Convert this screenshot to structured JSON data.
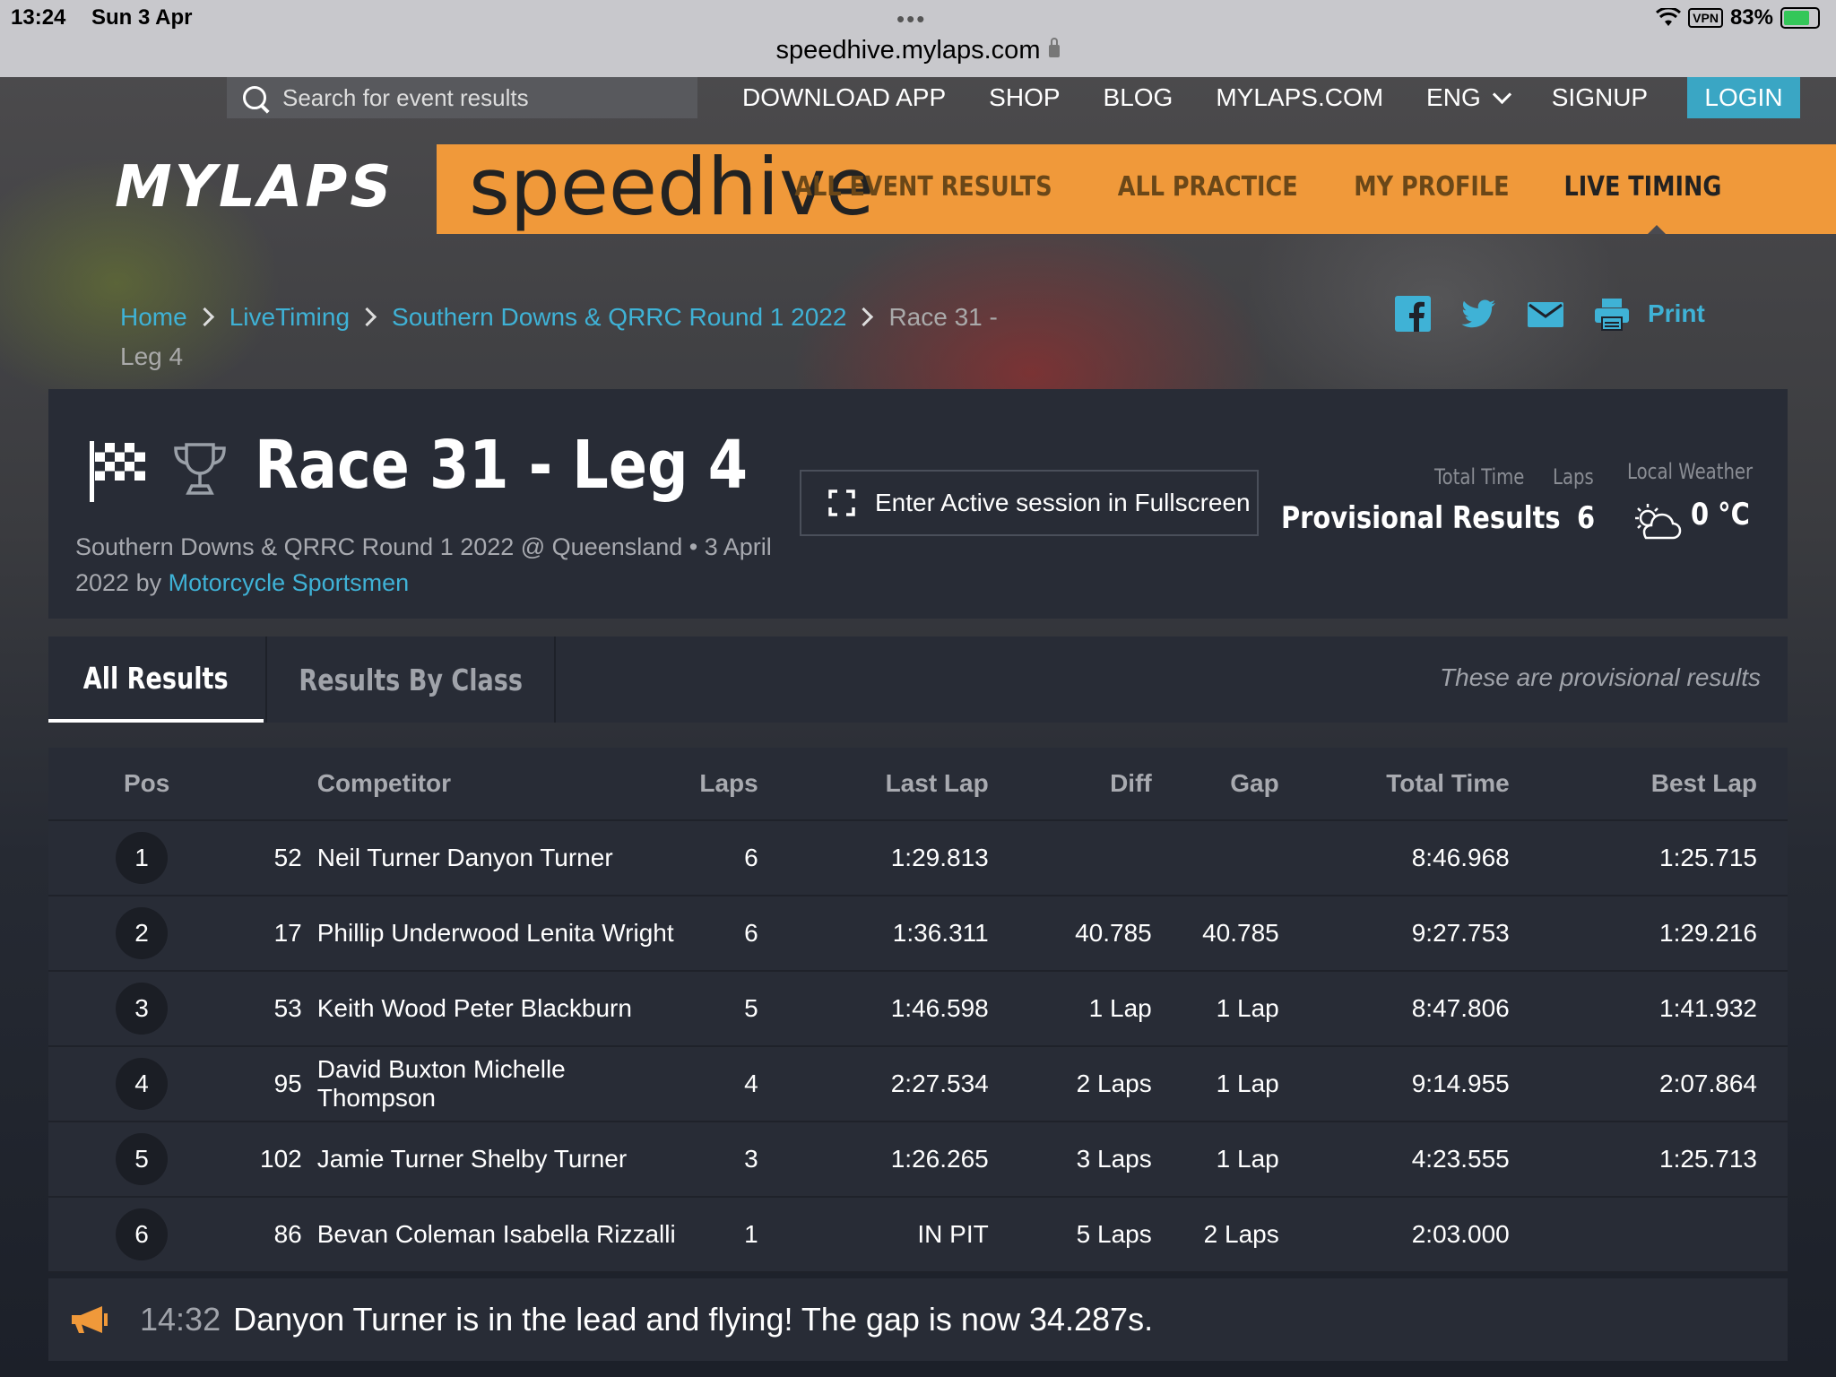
{
  "status_bar": {
    "time": "13:24",
    "date": "Sun 3 Apr",
    "url": "speedhive.mylaps.com",
    "vpn": "VPN",
    "battery": "83%"
  },
  "top_nav": {
    "search_placeholder": "Search for event results",
    "links": [
      "DOWNLOAD APP",
      "SHOP",
      "BLOG",
      "MYLAPS.COM"
    ],
    "language": "ENG",
    "signup": "SIGNUP",
    "login": "LOGIN"
  },
  "brand": {
    "mylaps": "MYLAPS",
    "speedhive": "speedhive",
    "nav": [
      "ALL EVENT RESULTS",
      "ALL PRACTICE",
      "MY PROFILE",
      "LIVE TIMING"
    ],
    "active_nav": "LIVE TIMING"
  },
  "breadcrumb": {
    "home": "Home",
    "livetiming": "LiveTiming",
    "event": "Southern Downs & QRRC Round 1 2022",
    "current": "Race 31 - Leg 4",
    "print": "Print"
  },
  "session": {
    "title": "Race 31 - Leg 4",
    "event_line": "Southern Downs & QRRC Round 1 2022 @ Queensland • 3 April 2022 by",
    "organizer": "Motorcycle Sportsmen",
    "fullscreen_label": "Enter Active session in Fullscreen",
    "total_time_label": "Total Time",
    "total_time_value": "Provisional Results",
    "laps_label": "Laps",
    "laps_value": "6",
    "weather_label": "Local Weather",
    "weather_value": "0 °C"
  },
  "tabs": {
    "all_results": "All Results",
    "by_class": "Results By Class",
    "note": "These are provisional results"
  },
  "table": {
    "headers": {
      "pos": "Pos",
      "competitor": "Competitor",
      "laps": "Laps",
      "last_lap": "Last Lap",
      "diff": "Diff",
      "gap": "Gap",
      "total_time": "Total Time",
      "best_lap": "Best Lap"
    },
    "rows": [
      {
        "pos": "1",
        "num": "52",
        "name": "Neil Turner Danyon Turner",
        "laps": "6",
        "last_lap": "1:29.813",
        "diff": "",
        "gap": "",
        "total_time": "8:46.968",
        "best_lap": "1:25.715"
      },
      {
        "pos": "2",
        "num": "17",
        "name": "Phillip Underwood Lenita Wright",
        "laps": "6",
        "last_lap": "1:36.311",
        "diff": "40.785",
        "gap": "40.785",
        "total_time": "9:27.753",
        "best_lap": "1:29.216"
      },
      {
        "pos": "3",
        "num": "53",
        "name": "Keith Wood Peter Blackburn",
        "laps": "5",
        "last_lap": "1:46.598",
        "diff": "1 Lap",
        "gap": "1 Lap",
        "total_time": "8:47.806",
        "best_lap": "1:41.932"
      },
      {
        "pos": "4",
        "num": "95",
        "name": "David Buxton Michelle Thompson",
        "laps": "4",
        "last_lap": "2:27.534",
        "diff": "2 Laps",
        "gap": "1 Lap",
        "total_time": "9:14.955",
        "best_lap": "2:07.864"
      },
      {
        "pos": "5",
        "num": "102",
        "name": "Jamie Turner Shelby Turner",
        "laps": "3",
        "last_lap": "1:26.265",
        "diff": "3 Laps",
        "gap": "1 Lap",
        "total_time": "4:23.555",
        "best_lap": "1:25.713"
      },
      {
        "pos": "6",
        "num": "86",
        "name": "Bevan Coleman Isabella Rizzalli",
        "laps": "1",
        "last_lap": "IN PIT",
        "diff": "5 Laps",
        "gap": "2 Laps",
        "total_time": "2:03.000",
        "best_lap": ""
      }
    ]
  },
  "ticker": {
    "time": "14:32",
    "message": "Danyon Turner is in the lead and flying! The gap is now 34.287s."
  },
  "colors": {
    "brand_orange": "#f0993a",
    "link_blue": "#3fb2d6",
    "login_blue": "#3aa6c4",
    "panel": "#282c36"
  }
}
